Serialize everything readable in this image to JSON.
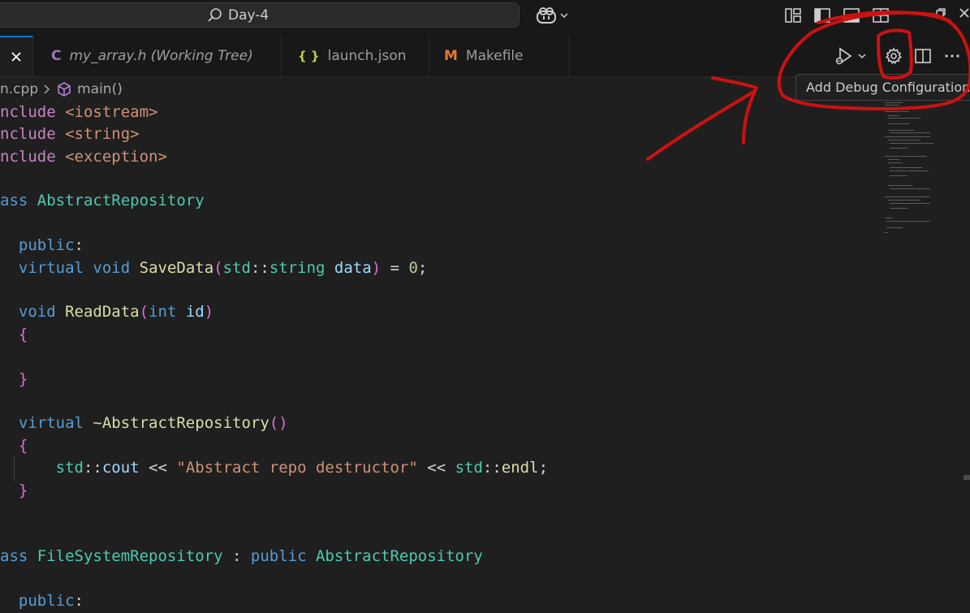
{
  "titlebar": {
    "search_text": "Day-4",
    "icons": [
      "search-icon",
      "copilot-icon",
      "chevron-down-icon",
      "customize-layout-icon",
      "toggle-primary-sidebar-icon",
      "toggle-panel-icon",
      "toggle-secondary-sidebar-icon",
      "restore-icon",
      "close-icon"
    ]
  },
  "tabs": [
    {
      "glyph": "C",
      "label": "my_array.h (Working Tree)",
      "italic": true,
      "glyph_color": "#a074c4"
    },
    {
      "glyph": "{ }",
      "label": "launch.json",
      "italic": false,
      "glyph_color": "#cbcb41"
    },
    {
      "glyph": "M",
      "label": "Makefile",
      "italic": false,
      "glyph_color": "#e37933"
    }
  ],
  "breadcrumb": {
    "file": "n.cpp",
    "symbol": "main()"
  },
  "tooltip": {
    "text": "Add Debug Configuration"
  },
  "colors": {
    "accent": "#0078d4",
    "annotation": "#cc1111",
    "editor_bg": "#1f1f1f"
  }
}
